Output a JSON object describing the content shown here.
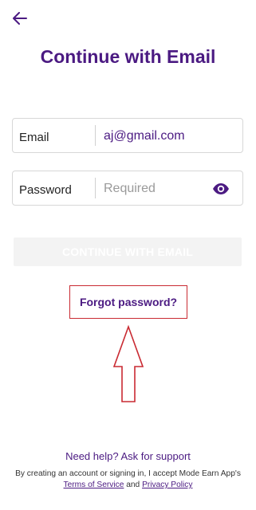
{
  "header": {
    "back_icon": "arrow-left-icon",
    "title": "Continue with Email"
  },
  "form": {
    "email_label": "Email",
    "email_value": "aj@gmail.com",
    "password_label": "Password",
    "password_placeholder": "Required",
    "password_toggle_icon": "eye-icon"
  },
  "actions": {
    "continue_label": "CONTINUE WITH EMAIL",
    "forgot_label": "Forgot password?"
  },
  "annotation": {
    "highlight_color": "#c92a32",
    "arrow_icon": "up-arrow-outline"
  },
  "footer": {
    "help_link": "Need help? Ask for support",
    "legal_text_1": "By creating an account or signing in, I accept Mode Earn App's",
    "terms_link": "Terms of Service",
    "legal_and": "and",
    "privacy_link": "Privacy Policy"
  },
  "colors": {
    "brand": "#4b1a82",
    "disabled_bg": "#f3f3f3"
  }
}
